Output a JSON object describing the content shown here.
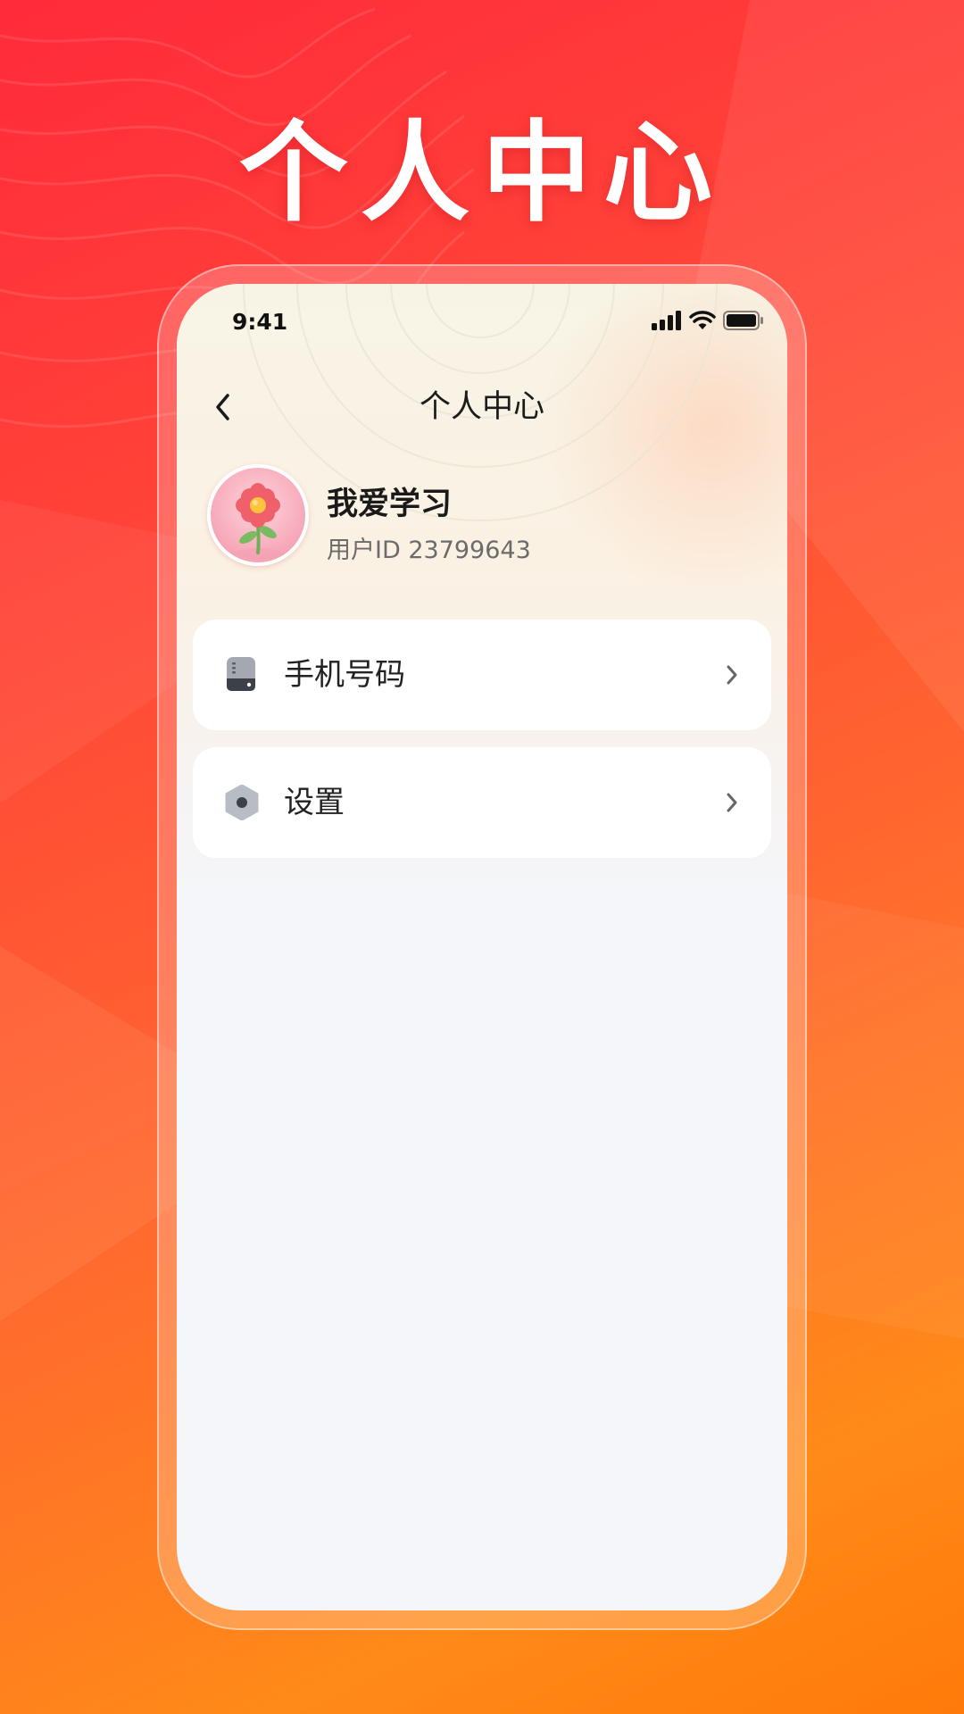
{
  "headline": "个人中心",
  "status_bar": {
    "time": "9:41",
    "icons": [
      "signal-icon",
      "wifi-icon",
      "battery-icon"
    ]
  },
  "nav": {
    "title": "个人中心",
    "back_icon": "chevron-left-icon"
  },
  "profile": {
    "avatar": "flower-avatar",
    "name": "我爱学习",
    "user_id": "用户ID 23799643"
  },
  "menu": [
    {
      "label": "手机号码",
      "icon": "phone-device-icon",
      "trailing_icon": "chevron-right-icon"
    },
    {
      "label": "设置",
      "icon": "settings-hex-icon",
      "trailing_icon": "chevron-right-icon"
    }
  ],
  "colors": {
    "background_start": "#ff2a3a",
    "background_end": "#ff8a18",
    "screen_bg": "#f4f6fa",
    "card_bg": "#ffffff",
    "text_primary": "#1a1a1a",
    "text_secondary": "#6b6b6b"
  }
}
